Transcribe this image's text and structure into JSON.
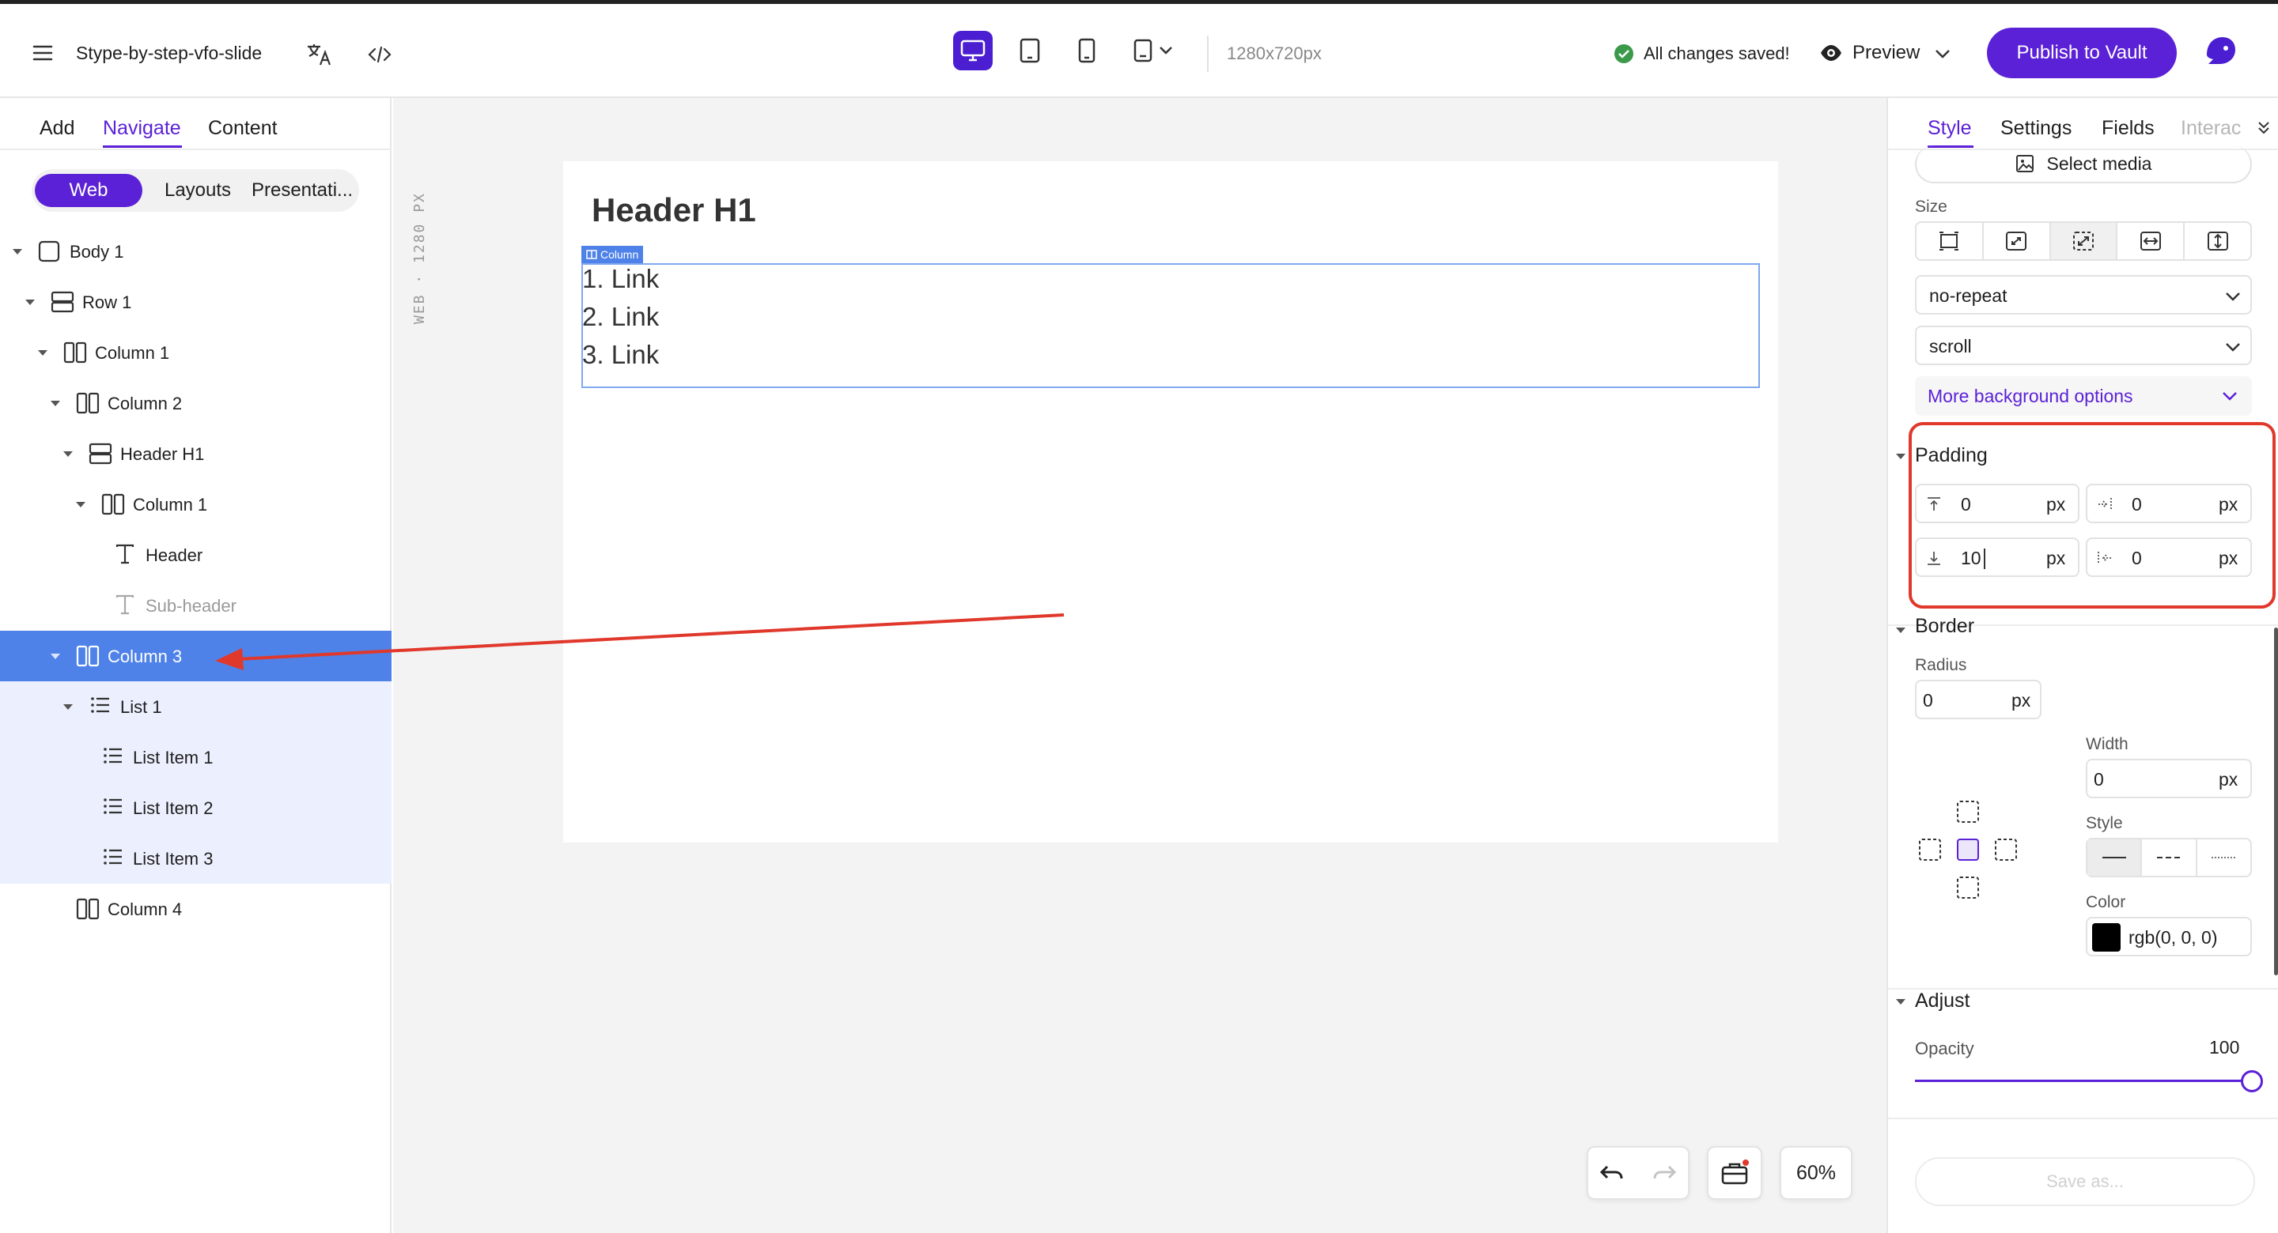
{
  "topbar": {
    "project_name": "Stype-by-step-vfo-slide",
    "resolution": "1280x720px",
    "save_status": "All changes saved!",
    "preview_label": "Preview",
    "publish_label": "Publish to Vault",
    "active_device": "desktop"
  },
  "left_panel": {
    "tabs": [
      {
        "label": "Add",
        "active": false
      },
      {
        "label": "Navigate",
        "active": true
      },
      {
        "label": "Content",
        "active": false
      }
    ],
    "segments": [
      {
        "label": "Web",
        "active": true
      },
      {
        "label": "Layouts",
        "active": false
      },
      {
        "label": "Presentati...",
        "active": false
      }
    ],
    "tree": [
      {
        "label": "Body 1",
        "icon": "box-icon",
        "state": "normal"
      },
      {
        "label": "Row 1",
        "icon": "row-icon",
        "state": "normal"
      },
      {
        "label": "Column 1",
        "icon": "column-icon",
        "state": "normal"
      },
      {
        "label": "Column 2",
        "icon": "column-icon",
        "state": "normal"
      },
      {
        "label": "Header H1",
        "icon": "row-icon",
        "state": "normal"
      },
      {
        "label": "Column 1",
        "icon": "column-icon",
        "state": "normal"
      },
      {
        "label": "Header",
        "icon": "text-icon",
        "state": "normal"
      },
      {
        "label": "Sub-header",
        "icon": "text-icon",
        "state": "muted"
      },
      {
        "label": "Column 3",
        "icon": "column-icon",
        "state": "selected"
      },
      {
        "label": "List 1",
        "icon": "list-icon",
        "state": "sub"
      },
      {
        "label": "List Item 1",
        "icon": "list-icon",
        "state": "sub"
      },
      {
        "label": "List Item 2",
        "icon": "list-icon",
        "state": "sub"
      },
      {
        "label": "List Item 3",
        "icon": "list-icon",
        "state": "sub"
      },
      {
        "label": "Column 4",
        "icon": "column-icon",
        "state": "normal"
      }
    ]
  },
  "canvas": {
    "ruler_label": "WEB · 1280 PX",
    "header_text": "Header H1",
    "column_tag": "Column",
    "list_items": [
      "1. Link",
      "2. Link",
      "3. Link"
    ],
    "zoom": "60%"
  },
  "right_panel": {
    "tabs": [
      {
        "label": "Style",
        "active": true
      },
      {
        "label": "Settings",
        "active": false
      },
      {
        "label": "Fields",
        "active": false
      },
      {
        "label": "Interac",
        "active": false
      }
    ],
    "select_media_label": "Select media",
    "size_label": "Size",
    "repeat_value": "no-repeat",
    "attachment_value": "scroll",
    "more_bg_label": "More background options",
    "padding": {
      "title": "Padding",
      "top": "0",
      "right": "0",
      "bottom": "10",
      "left": "0",
      "unit": "px"
    },
    "border": {
      "title": "Border",
      "radius_label": "Radius",
      "radius_value": "0",
      "width_label": "Width",
      "width_value": "0",
      "style_label": "Style",
      "color_label": "Color",
      "color_value": "rgb(0, 0, 0)",
      "unit": "px"
    },
    "adjust": {
      "title": "Adjust",
      "opacity_label": "Opacity",
      "opacity_value": "100"
    },
    "save_as_label": "Save as..."
  },
  "colors": {
    "accent": "#5b21d6",
    "selection": "#4f82e8",
    "annotation": "#e0382b",
    "success": "#3a9a4a"
  }
}
